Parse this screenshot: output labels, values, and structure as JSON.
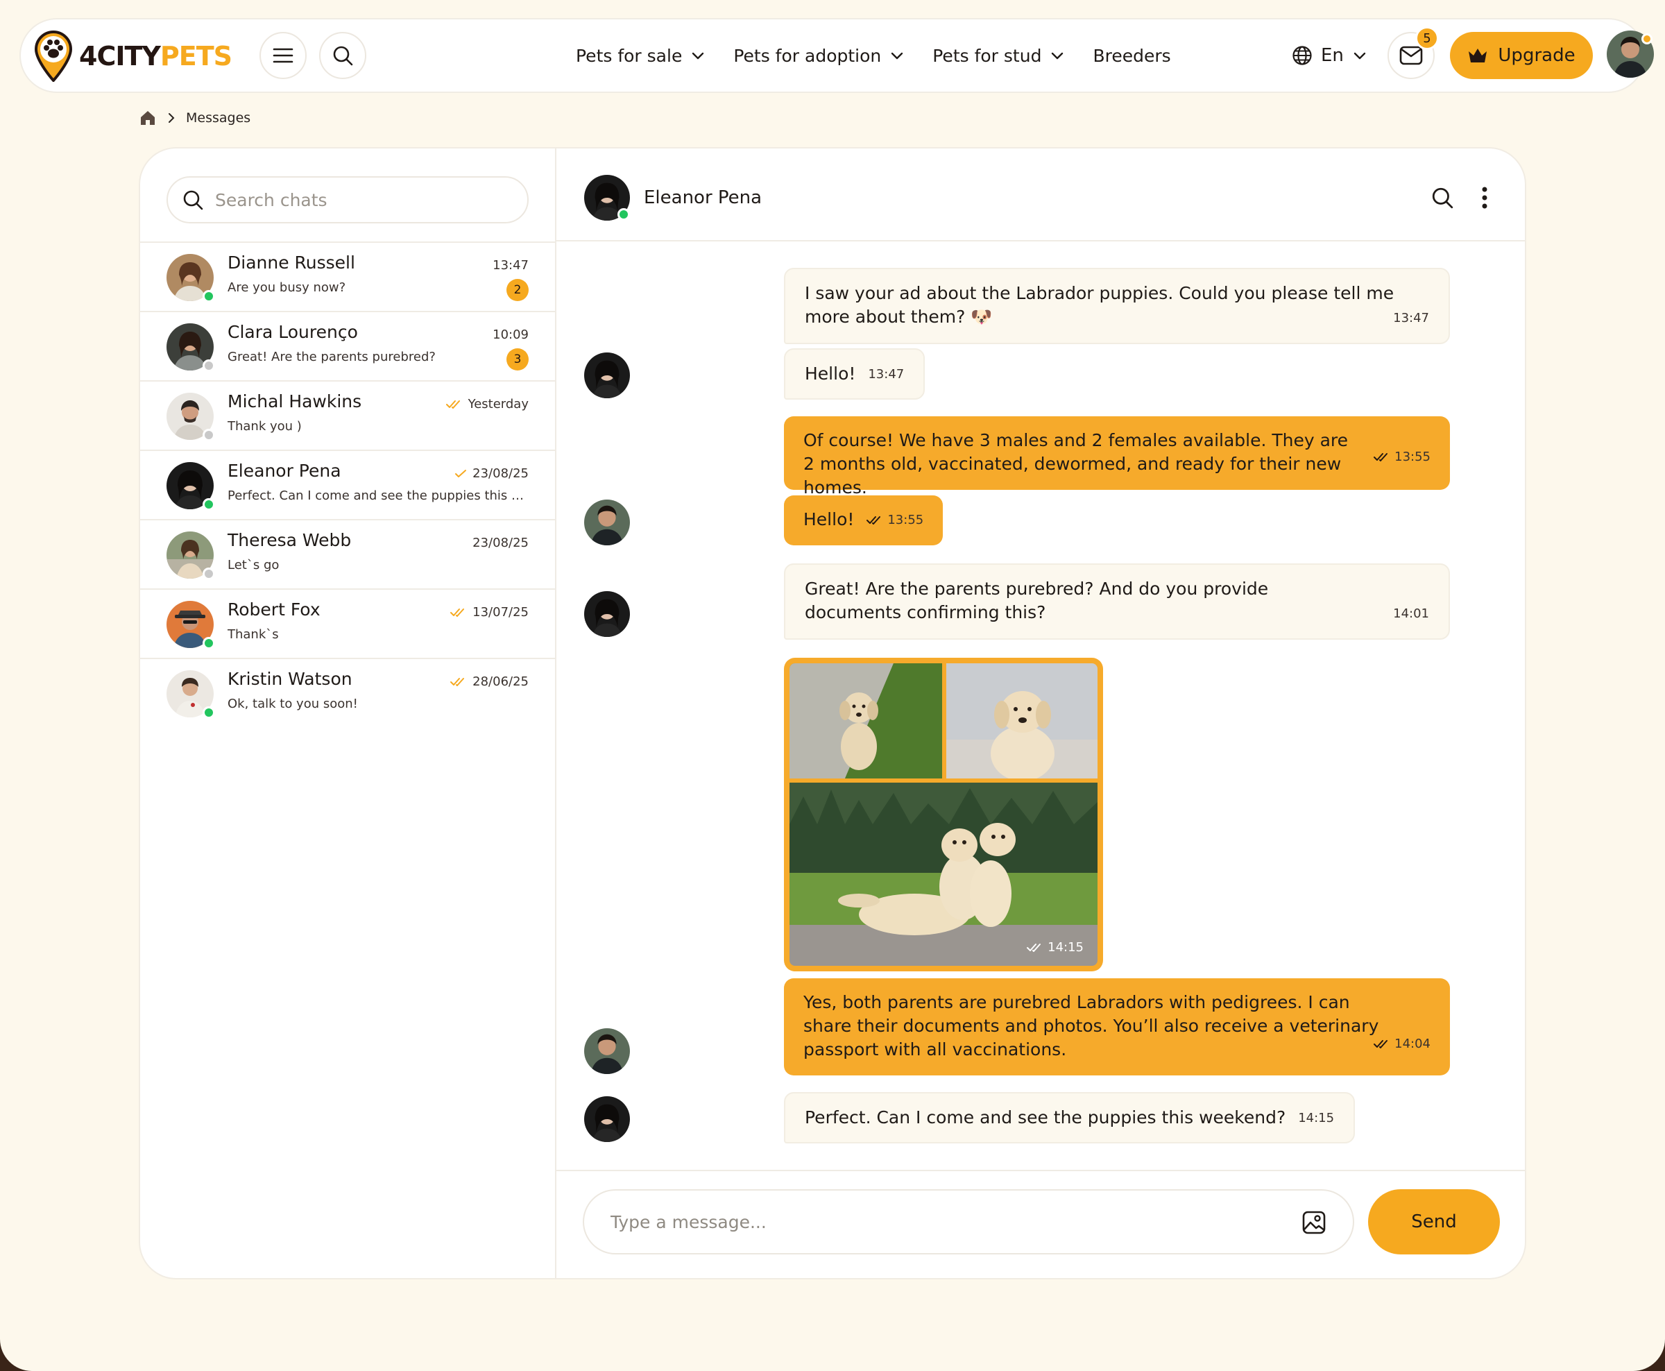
{
  "brand": {
    "part1": "4CITY",
    "part2": "PETS",
    "accent": "#f6a91f",
    "dark": "#241612"
  },
  "header": {
    "nav": [
      {
        "label": "Pets for sale",
        "dropdown": true
      },
      {
        "label": "Pets for adoption",
        "dropdown": true
      },
      {
        "label": "Pets for stud",
        "dropdown": true
      },
      {
        "label": "Breeders",
        "dropdown": false
      }
    ],
    "language": "En",
    "mail_count": "5",
    "upgrade_label": "Upgrade"
  },
  "breadcrumb": {
    "current": "Messages"
  },
  "sidebar": {
    "search_placeholder": "Search chats",
    "chats": [
      {
        "name": "Dianne Russell",
        "preview": "Are you busy now?",
        "time": "13:47",
        "unread": "2",
        "online": true,
        "read": false
      },
      {
        "name": "Clara Lourenço",
        "preview": "Great! Are the parents purebred?",
        "time": "10:09",
        "unread": "3",
        "online": false,
        "read": false
      },
      {
        "name": "Michal Hawkins",
        "preview": "Thank you )",
        "time": "Yesterday",
        "unread": "",
        "online": false,
        "read": true
      },
      {
        "name": "Eleanor Pena",
        "preview": "Perfect. Can I come and see the puppies this weekend?",
        "time": "23/08/25",
        "unread": "",
        "online": true,
        "read": true
      },
      {
        "name": "Theresa Webb",
        "preview": "Let`s go",
        "time": "23/08/25",
        "unread": "",
        "online": false,
        "read": false
      },
      {
        "name": "Robert Fox",
        "preview": "Thank`s",
        "time": "13/07/25",
        "unread": "",
        "online": true,
        "read": true
      },
      {
        "name": "Kristin Watson",
        "preview": "Ok, talk to you soon!",
        "time": "28/06/25",
        "unread": "",
        "online": true,
        "read": true
      }
    ]
  },
  "conversation": {
    "contact_name": "Eleanor Pena",
    "messages": [
      {
        "dir": "in",
        "text": "I saw your ad about the Labrador puppies. Could you please tell me more about them? 🐶",
        "time": "13:47"
      },
      {
        "dir": "in",
        "text": "Hello!",
        "time": "13:47"
      },
      {
        "dir": "out",
        "text": "Of course! We have 3 males and 2 females available. They are 2 months old, vaccinated, dewormed, and ready for their new homes.",
        "time": "13:55"
      },
      {
        "dir": "out",
        "text": "Hello!",
        "time": "13:55"
      },
      {
        "dir": "in",
        "text": "Great! Are the parents purebred? And do you provide documents confirming this?",
        "time": "14:01"
      },
      {
        "dir": "out",
        "type": "images",
        "time": "14:15"
      },
      {
        "dir": "out",
        "text": "Yes, both parents are purebred Labradors with pedigrees. I can share their documents and photos. You’ll also receive a veterinary passport with all vaccinations.",
        "time": "14:04"
      },
      {
        "dir": "in",
        "text": "Perfect. Can I come and see the puppies this weekend?",
        "time": "14:15"
      }
    ],
    "composer_placeholder": "Type a message...",
    "send_label": "Send"
  }
}
